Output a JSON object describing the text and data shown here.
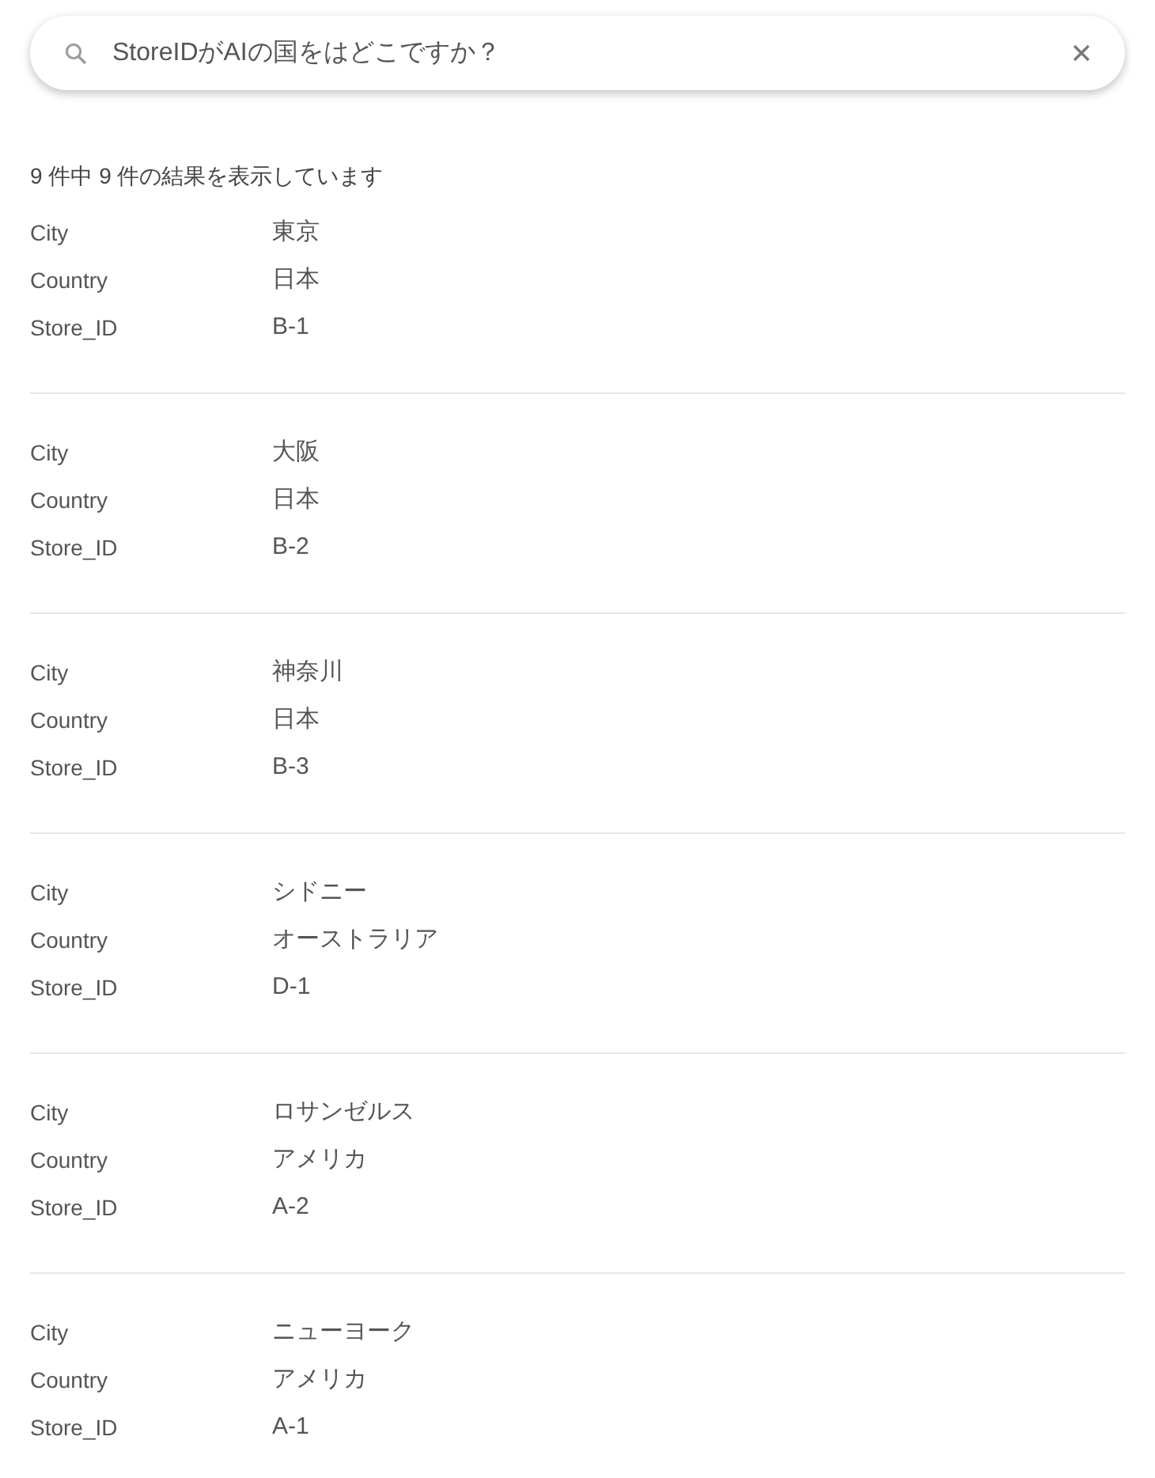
{
  "search": {
    "value": "StoreIDがAIの国をはどこですか？"
  },
  "result_count": "9 件中 9 件の結果を表示しています",
  "results": [
    {
      "fields": [
        {
          "label": "City",
          "value": "東京"
        },
        {
          "label": "Country",
          "value": "日本"
        },
        {
          "label": "Store_ID",
          "value": "B-1"
        }
      ]
    },
    {
      "fields": [
        {
          "label": "City",
          "value": "大阪"
        },
        {
          "label": "Country",
          "value": "日本"
        },
        {
          "label": "Store_ID",
          "value": "B-2"
        }
      ]
    },
    {
      "fields": [
        {
          "label": "City",
          "value": "神奈川"
        },
        {
          "label": "Country",
          "value": "日本"
        },
        {
          "label": "Store_ID",
          "value": "B-3"
        }
      ]
    },
    {
      "fields": [
        {
          "label": "City",
          "value": "シドニー"
        },
        {
          "label": "Country",
          "value": "オーストラリア"
        },
        {
          "label": "Store_ID",
          "value": "D-1"
        }
      ]
    },
    {
      "fields": [
        {
          "label": "City",
          "value": "ロサンゼルス"
        },
        {
          "label": "Country",
          "value": "アメリカ"
        },
        {
          "label": "Store_ID",
          "value": "A-2"
        }
      ]
    },
    {
      "fields": [
        {
          "label": "City",
          "value": "ニューヨーク"
        },
        {
          "label": "Country",
          "value": "アメリカ"
        },
        {
          "label": "Store_ID",
          "value": "A-1"
        }
      ]
    }
  ]
}
